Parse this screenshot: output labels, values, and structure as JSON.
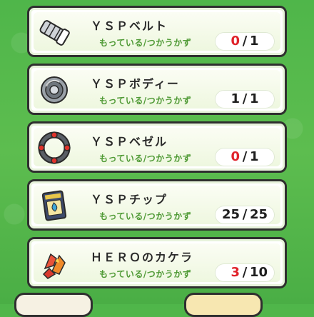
{
  "items": [
    {
      "name": "ＹＳＰベルト",
      "caption": "もっている/つかうかず",
      "have": "0",
      "need": "1",
      "have_color": "#e0232b",
      "icon": "belt-icon"
    },
    {
      "name": "ＹＳＰボディー",
      "caption": "もっている/つかうかず",
      "have": "1",
      "need": "1",
      "have_color": "#1e1e1e",
      "icon": "body-disc-icon"
    },
    {
      "name": "ＹＳＰベゼル",
      "caption": "もっている/つかうかず",
      "have": "0",
      "need": "1",
      "have_color": "#e0232b",
      "icon": "bezel-ring-icon"
    },
    {
      "name": "ＹＳＰチップ",
      "caption": "もっている/つかうかず",
      "have": "25",
      "need": "25",
      "have_color": "#1e1e1e",
      "icon": "chip-card-icon"
    },
    {
      "name": "ＨＥＲＯのカケラ",
      "caption": "もっている/つかうかず",
      "have": "3",
      "need": "10",
      "have_color": "#e0232b",
      "icon": "hero-fragment-icon"
    }
  ],
  "separator": "/",
  "colors": {
    "background": "#4fb64a",
    "caption": "#4f9a35",
    "shortage": "#e0232b"
  }
}
